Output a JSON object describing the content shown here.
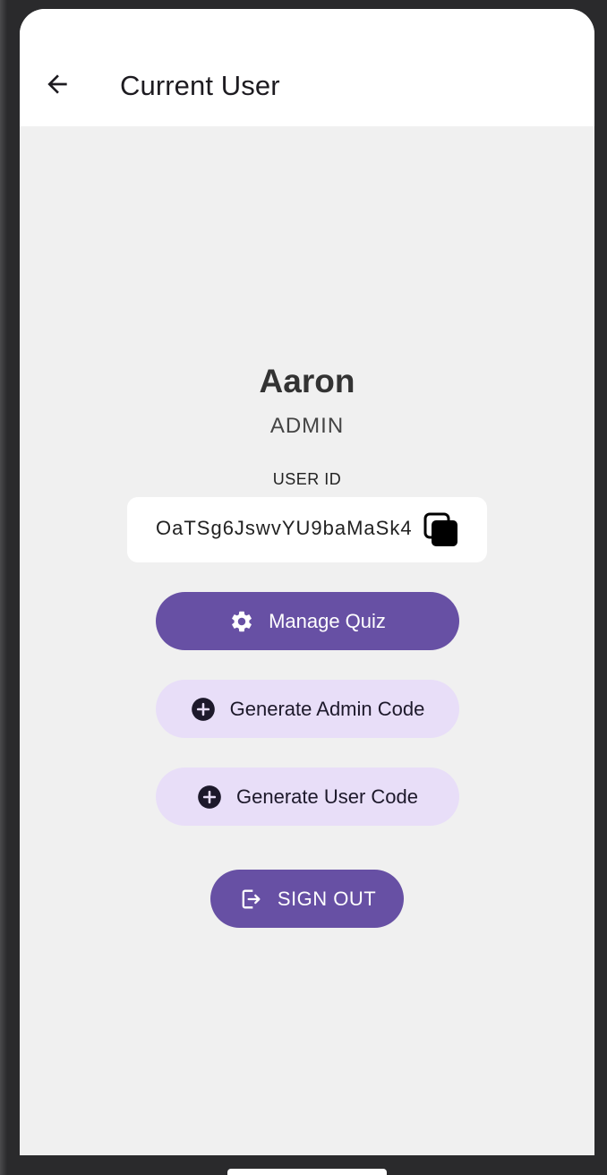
{
  "app_bar": {
    "back_icon": "arrow-back-icon",
    "title": "Current User"
  },
  "profile": {
    "name": "Aaron",
    "role": "ADMIN"
  },
  "user_id": {
    "label": "USER ID",
    "value": "OaTSg6JswvYU9baMaSk4",
    "copy_icon": "copy-icon"
  },
  "actions": {
    "manage_quiz": {
      "label": "Manage Quiz",
      "icon": "gear-icon"
    },
    "generate_admin_code": {
      "label": "Generate Admin Code",
      "icon": "add-circle-icon"
    },
    "generate_user_code": {
      "label": "Generate User Code",
      "icon": "add-circle-icon"
    },
    "sign_out": {
      "label": "SIGN OUT",
      "icon": "logout-icon"
    }
  },
  "colors": {
    "primary": "#6750a4",
    "tonal": "#e8def8",
    "background": "#f0f0f0",
    "surface": "#ffffff"
  }
}
